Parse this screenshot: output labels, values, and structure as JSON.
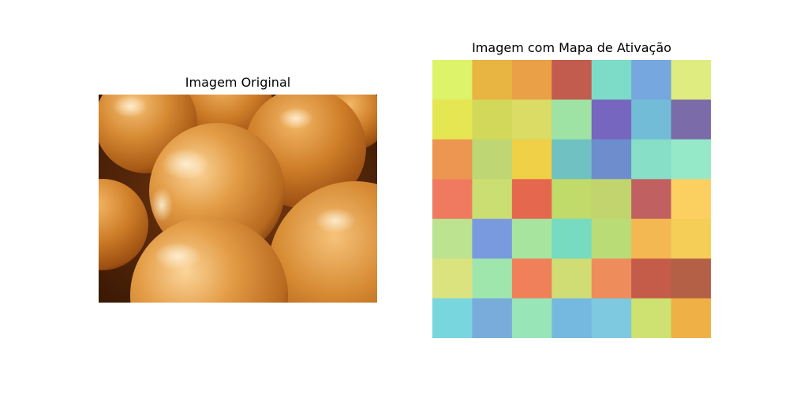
{
  "left_panel": {
    "title": "Imagem Original"
  },
  "right_panel": {
    "title": "Imagem com Mapa de Ativação",
    "grid": {
      "rows": 7,
      "cols": 7,
      "colors": [
        [
          "#dcf36a",
          "#e8b442",
          "#e9a046",
          "#c15c4f",
          "#7cdcc7",
          "#76a7df",
          "#deec80"
        ],
        [
          "#e6e652",
          "#d2d85a",
          "#dadc66",
          "#9ee3a4",
          "#7766bf",
          "#72bcd7",
          "#7b6ba9"
        ],
        [
          "#ec9652",
          "#bed774",
          "#f0d046",
          "#70c1c1",
          "#6d8dcd",
          "#88dfc8",
          "#96e9c8"
        ],
        [
          "#f07a60",
          "#cbde72",
          "#e5684e",
          "#c0db6a",
          "#c2d46e",
          "#c06060",
          "#fbd060"
        ],
        [
          "#bce390",
          "#7a9adf",
          "#a7e59f",
          "#76dbc1",
          "#b9dc76",
          "#f4b852",
          "#f4ce56"
        ],
        [
          "#dae37e",
          "#9fe6ad",
          "#f0805a",
          "#d0dd74",
          "#ef8c5c",
          "#c55c4a",
          "#b46046"
        ],
        [
          "#78d6df",
          "#79acdb",
          "#98e6b8",
          "#76b9e0",
          "#7ec8e0",
          "#cde271",
          "#efb046"
        ]
      ]
    }
  }
}
